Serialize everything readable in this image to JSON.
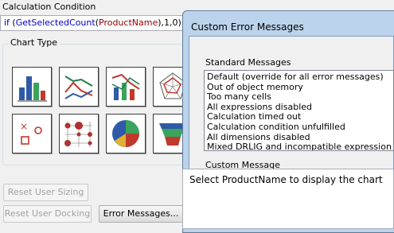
{
  "calc": {
    "label": "Calculation Condition",
    "kw": "if",
    "open": " (",
    "fn": "GetSelectedCount",
    "paren": "(",
    "field": "ProductName",
    "rest": "),1,0)"
  },
  "chart_type": {
    "title": "Chart Type",
    "icons": [
      "bar-chart-icon",
      "line-chart-icon",
      "combo-chart-icon",
      "radar-chart-icon",
      "scatter-chart-icon",
      "grid-chart-icon",
      "pie-chart-icon",
      "funnel-chart-icon"
    ]
  },
  "buttons": {
    "reset_sizing": "Reset User Sizing",
    "reset_docking": "Reset User Docking",
    "error_messages": "Error Messages..."
  },
  "dialog": {
    "title": "Custom Error Messages",
    "standard_label": "Standard Messages",
    "standard_items": [
      "Default (override for all error messages)",
      "Out of object memory",
      "Too many cells",
      "All expressions disabled",
      "Calculation timed out",
      "Calculation condition unfulfilled",
      "All dimensions disabled",
      "Mixed DRLIG and incompatible expressions"
    ],
    "custom_label": "Custom Message",
    "custom_value": "Select ProductName to display the chart"
  }
}
